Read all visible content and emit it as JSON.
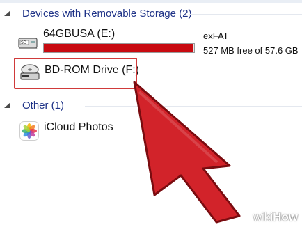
{
  "groups": [
    {
      "title": "Devices with Removable Storage (2)"
    },
    {
      "title": "Other (1)"
    }
  ],
  "drives": [
    {
      "name": "64GBUSA (E:)",
      "filesystem": "exFAT",
      "free_text": "527 MB free of 57.6 GB",
      "used_fraction": 0.99,
      "bar_color": "#c80a10",
      "icon": "usb-drive-icon"
    },
    {
      "name": "BD-ROM Drive (F:)",
      "icon": "optical-drive-icon"
    }
  ],
  "other_items": [
    {
      "name": "iCloud Photos",
      "icon": "photos-icon"
    }
  ],
  "overlay": {
    "highlight_color": "#d03a3a",
    "arrow_color": "#d2232a"
  },
  "watermark": {
    "brand_light": "wiki",
    "brand_bold": "How"
  }
}
